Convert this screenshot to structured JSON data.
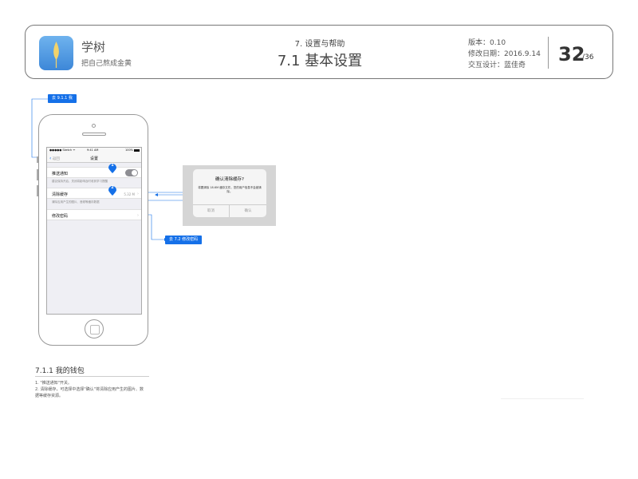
{
  "header": {
    "app_name": "学树",
    "app_slogan": "把自己熬成金黄",
    "section_sub": "7. 设置与帮助",
    "section_title": "7.1 基本设置",
    "version": "版本：0.10",
    "modified": "修改日期：2016.9.14",
    "designer": "交互设计：蓝佳奇",
    "page_current": "32",
    "page_total": "/36"
  },
  "tags": {
    "top": "去 9.1.1 我",
    "bottom": "去 7.2 修改密码"
  },
  "phone": {
    "status": {
      "carrier": "●●●●● Sketch ᯤ",
      "time": "9:41 AM",
      "battery": "100%"
    },
    "nav": {
      "back": "返回",
      "title": "设置"
    },
    "push": {
      "label": "推送通知",
      "note": "建议保持开启，关闭将影响及时收到学习提醒"
    },
    "cache": {
      "label": "清除缓存",
      "value": "5.32 M",
      "note": "清除应用产生的图片、音频等缓存数据"
    },
    "password": {
      "label": "修改密码"
    },
    "markers": [
      "1",
      "2"
    ]
  },
  "dialog": {
    "title": "确认清除缓存?",
    "message": "将要清除 18.6M 缓存文件，您的用户信息不会被清除。",
    "cancel": "取消",
    "confirm": "确认"
  },
  "notes": {
    "title": "7.1.1 我的钱包",
    "line1": "1. \"推送通知\"开关。",
    "line2": "2. 清除缓存，可选择中选择\"确认\"将清除应用产生的图片、数",
    "line3": "据等缓存资源。"
  },
  "colors": {
    "accent": "#1570e8",
    "screen_bg": "#efeff4",
    "dialog_bg": "#d5d5d5"
  }
}
